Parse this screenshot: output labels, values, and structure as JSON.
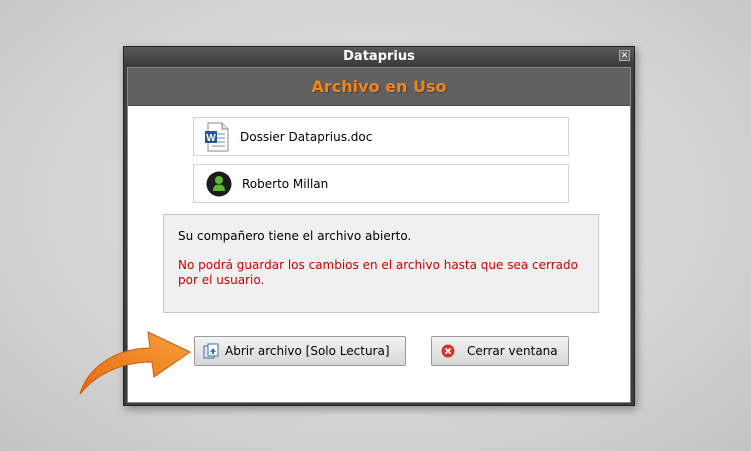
{
  "window": {
    "title": "Dataprius",
    "close_glyph": "✕"
  },
  "dialog": {
    "heading": "Archivo en Uso",
    "file_name": "Dossier Dataprius.doc",
    "user_name": "Roberto Millan",
    "message_info": "Su compañero tiene el archivo abierto.",
    "message_warning": "No podrá guardar los cambios en el archivo  hasta que sea cerrado por el usuario."
  },
  "buttons": {
    "open_readonly": "Abrir archivo [Solo Lectura]",
    "close_window": "Cerrar ventana"
  },
  "icons": {
    "file": "word-document-icon",
    "user": "user-icon",
    "open": "open-readonly-icon",
    "close": "close-circle-icon",
    "pointer": "orange-arrow-icon"
  },
  "colors": {
    "heading": "#f0841e",
    "warning_text": "#cc0000",
    "arrow": "#f07d1a"
  }
}
